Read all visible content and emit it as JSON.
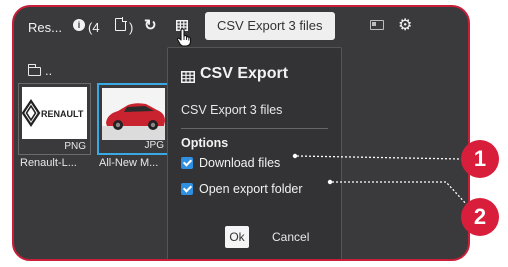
{
  "toolbar": {
    "title": "Res...",
    "info_symbol": "i",
    "count_open": "(4",
    "count_close": ")",
    "refresh_symbol": "↻",
    "gear_symbol": "⚙",
    "tooltip": "CSV Export 3 files"
  },
  "browser": {
    "folder_label": "..",
    "items": [
      {
        "name": "Renault-L...",
        "ext": "PNG",
        "logo_text": "RENAULT"
      },
      {
        "name": "All-New M...",
        "ext": "JPG"
      }
    ]
  },
  "dialog": {
    "title": "CSV Export",
    "description": "CSV Export 3 files",
    "options_heading": "Options",
    "options": [
      {
        "label": "Download files",
        "checked": true
      },
      {
        "label": "Open export folder",
        "checked": true
      }
    ],
    "ok_label": "Ok",
    "cancel_label": "Cancel"
  },
  "annotations": {
    "badge_1": "1",
    "badge_2": "2"
  },
  "colors": {
    "frame_border": "#c81e3a",
    "badge": "#d81e3a",
    "checkbox": "#2f8fe0",
    "selection_border": "#39a9e3"
  }
}
